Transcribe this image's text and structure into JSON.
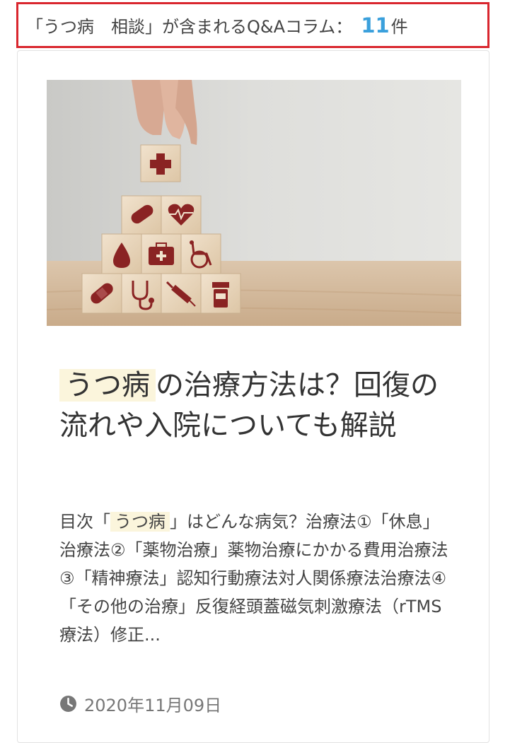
{
  "search_result": {
    "prefix": "「",
    "keyword": "うつ病　相談",
    "suffix": "」が含まれるQ&Aコラム：",
    "count": "11",
    "count_unit": "件"
  },
  "article": {
    "image_icons": [
      "plus-icon",
      "pill-icon",
      "heart-icon",
      "blood-drop-icon",
      "first-aid-kit-icon",
      "wheelchair-icon",
      "bandage-icon",
      "stethoscope-icon",
      "syringe-icon",
      "medicine-bottle-icon"
    ],
    "title_highlight": "うつ病",
    "title_rest": "の治療方法は？回復の流れや入院についても解説",
    "excerpt_before": "目次「",
    "excerpt_highlight": "うつ病",
    "excerpt_after": "」はどんな病気？治療法①「休息」治療法②「薬物治療」薬物治療にかかる費用治療法③「精神療法」認知行動療法対人関係療法治療法④「その他の治療」反復経頭蓋磁気刺激療法（rTMS療法）修正...",
    "date": "2020年11月09日"
  },
  "colors": {
    "header_border": "#d9262e",
    "count_color": "#3aa0dc",
    "highlight_bg": "#fbf5dc",
    "icon_color": "#8a2323"
  }
}
